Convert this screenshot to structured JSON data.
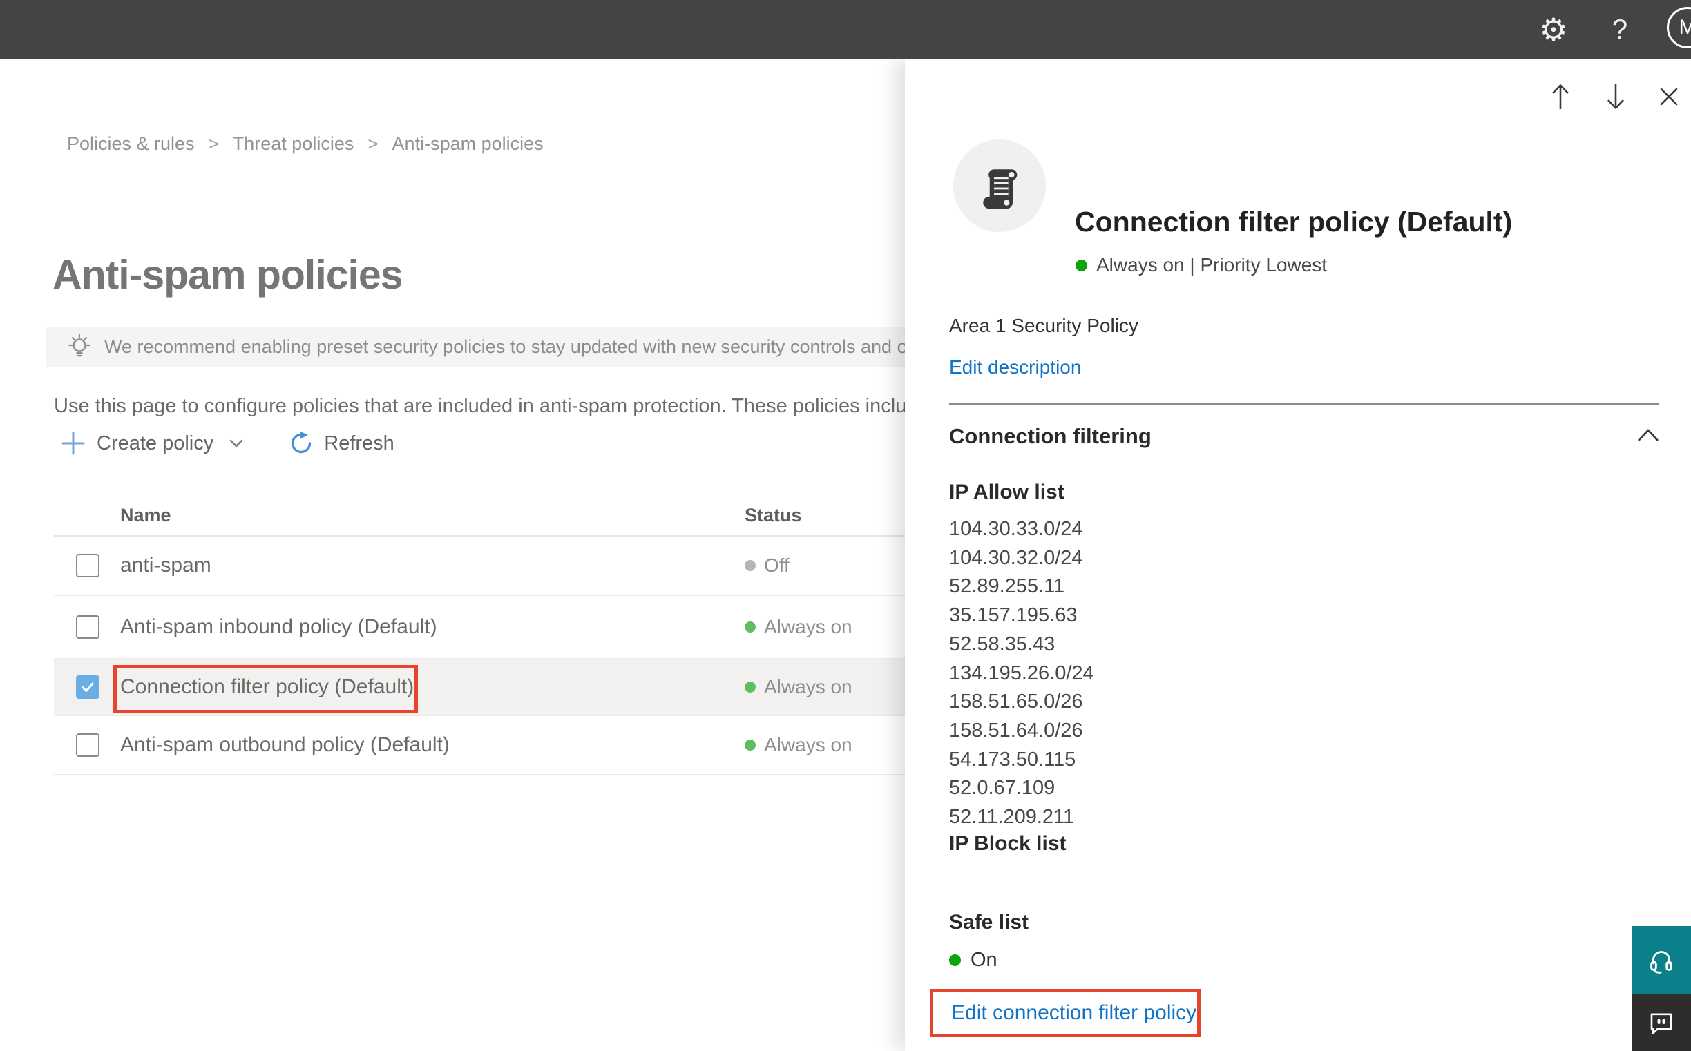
{
  "topbar": {
    "settings_glyph": "⚙",
    "help_glyph": "?",
    "avatar_initial": "M"
  },
  "breadcrumb": {
    "separator": ">",
    "items": [
      "Policies & rules",
      "Threat policies",
      "Anti-spam policies"
    ]
  },
  "page": {
    "title": "Anti-spam policies",
    "banner_text": "We recommend enabling preset security policies to stay updated with new security controls and our recomme",
    "description": "Use this page to configure policies that are included in anti-spam protection. These policies include"
  },
  "toolbar": {
    "create_policy_label": "Create policy",
    "refresh_label": "Refresh"
  },
  "policy_table": {
    "columns": [
      "Name",
      "Status"
    ],
    "rows": [
      {
        "name": "anti-spam",
        "status": "Off",
        "checked": false
      },
      {
        "name": "Anti-spam inbound policy (Default)",
        "status": "Always on",
        "checked": false
      },
      {
        "name": "Connection filter policy (Default)",
        "status": "Always on",
        "checked": true
      },
      {
        "name": "Anti-spam outbound policy (Default)",
        "status": "Always on",
        "checked": false
      }
    ]
  },
  "flyout": {
    "title": "Connection filter policy (Default)",
    "status_line": "Always on | Priority Lowest",
    "description": "Area 1 Security Policy",
    "edit_description_label": "Edit description",
    "section_heading": "Connection filtering",
    "ip_allow": {
      "heading": "IP Allow list",
      "items": [
        "104.30.33.0/24",
        "104.30.32.0/24",
        "52.89.255.11",
        "35.157.195.63",
        "52.58.35.43",
        "134.195.26.0/24",
        "158.51.65.0/26",
        "158.51.64.0/26",
        "54.173.50.115",
        "52.0.67.109",
        "52.11.209.211"
      ]
    },
    "ip_block_heading": "IP Block list",
    "safe_list": {
      "heading": "Safe list",
      "status": "On"
    },
    "edit_link_label": "Edit connection filter policy"
  },
  "colors": {
    "topbar_bg": "#464442",
    "link_blue": "#1173c4",
    "status_green": "#5fbe5f",
    "status_gray": "#b8b5b2",
    "flyout_status_green": "#0da50d",
    "annotation_red": "#e8432d",
    "checked_checkbox_blue": "#69afe5",
    "selected_row_bg": "#f2f1ef",
    "support_teal": "#0b7f8a",
    "feedback_dark": "#2f2d2b"
  }
}
